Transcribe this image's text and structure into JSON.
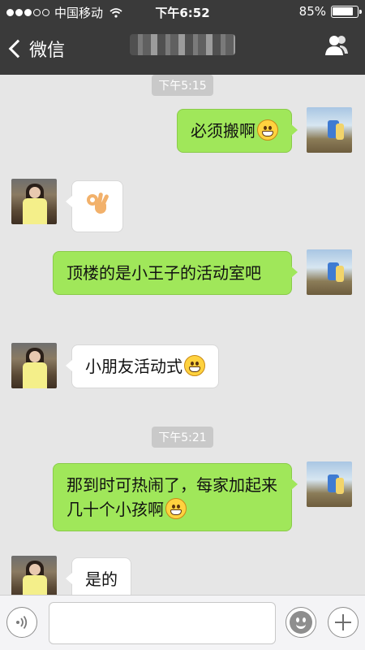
{
  "status_bar": {
    "carrier": "中国移动",
    "time": "下午6:52",
    "battery_percent": "85%",
    "battery_level": 0.85,
    "signal_dots_filled": 3,
    "signal_dots_total": 5,
    "icons": [
      "signal-dots",
      "wifi-icon",
      "battery-icon"
    ]
  },
  "nav_bar": {
    "back_label": "微信",
    "back_icon": "chevron-left-icon",
    "right_icon": "contact-profile-icon",
    "title_obscured": true
  },
  "colors": {
    "nav_background": "#3a3a3a",
    "chat_background": "#e6e6e6",
    "outgoing_bubble": "#a0e75a",
    "incoming_bubble": "#ffffff"
  },
  "messages": [
    {
      "kind": "time",
      "text": "下午5:15"
    },
    {
      "kind": "out",
      "text": "必须搬啊",
      "emoji": "grin"
    },
    {
      "kind": "in",
      "text": "",
      "sticker": "ok-hand"
    },
    {
      "kind": "out",
      "text": "顶楼的是小王子的活动室吧"
    },
    {
      "kind": "in",
      "text": "小朋友活动式",
      "emoji": "grin"
    },
    {
      "kind": "time",
      "text": "下午5:21"
    },
    {
      "kind": "out",
      "text": "那到时可热闹了，每家加起来几十个小孩啊",
      "emoji": "grin"
    },
    {
      "kind": "in",
      "text": "是的"
    }
  ],
  "input_bar": {
    "voice_icon": "voice-icon",
    "input_value": "",
    "emoji_icon": "smiley-face-icon",
    "plus_icon": "plus-icon"
  }
}
